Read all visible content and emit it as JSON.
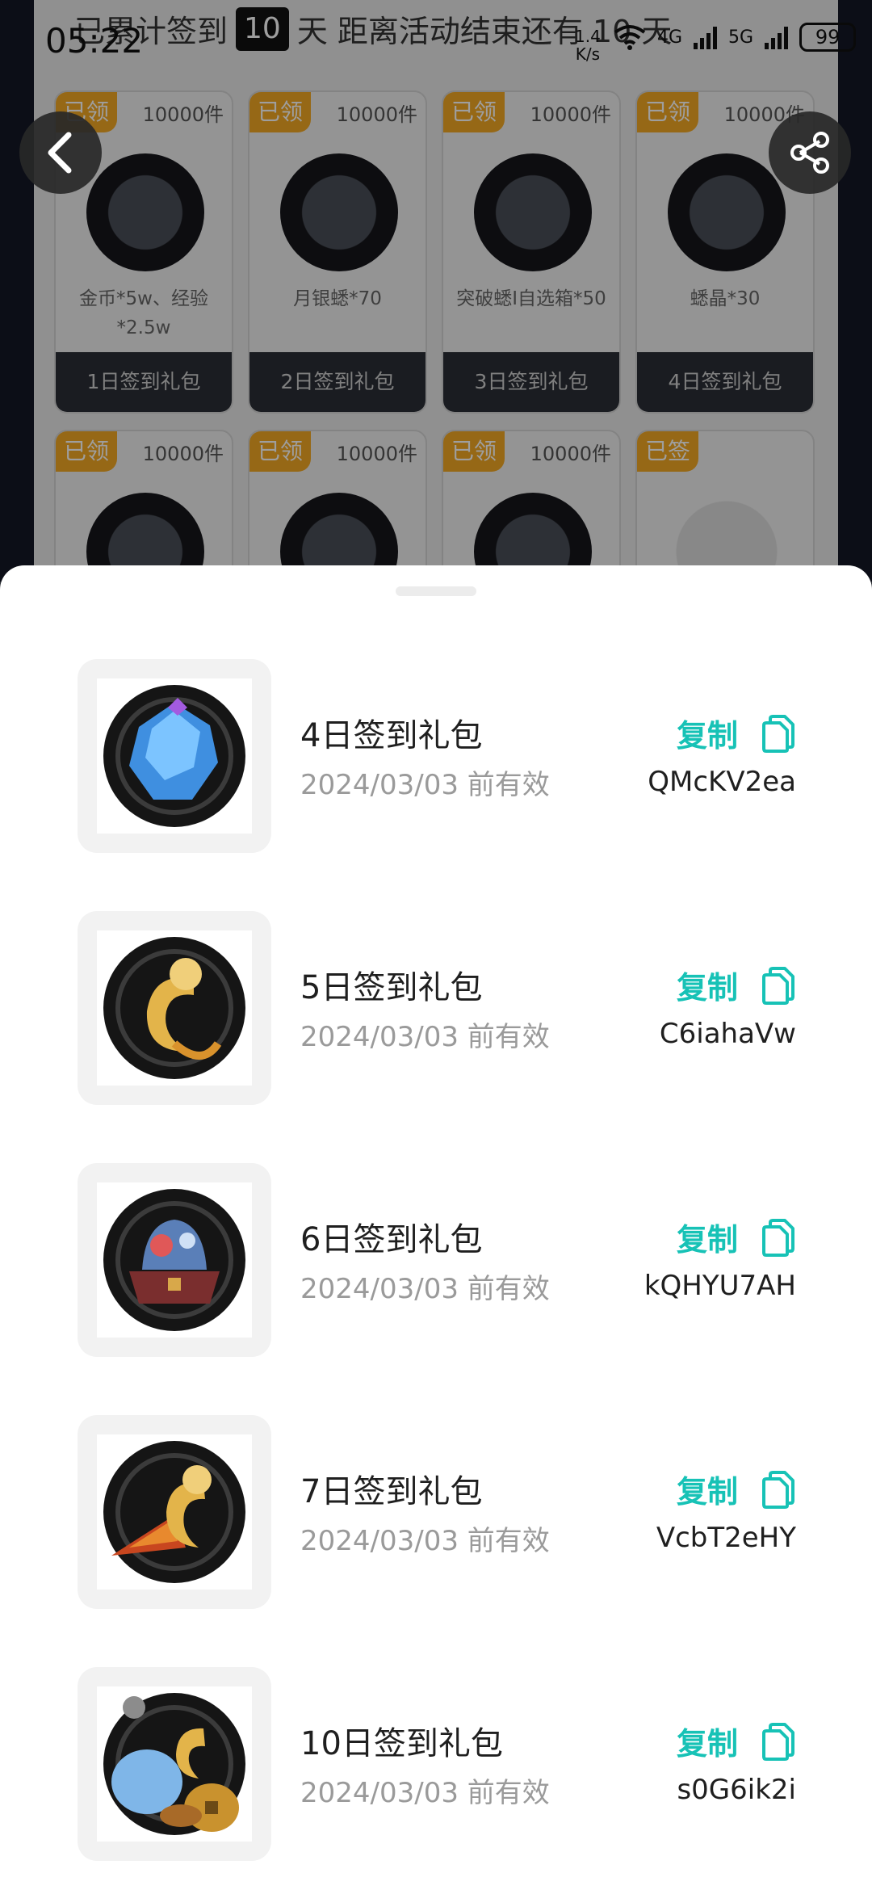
{
  "status_bar": {
    "time": "05:22",
    "net_speed": "1.4",
    "net_unit": "K/s",
    "signal_4g": "4G",
    "signal_5g": "5G",
    "battery": "99"
  },
  "background": {
    "headline_prefix": "已累计签到",
    "headline_days": "10",
    "headline_suffix": "天  距离活动结束还有 10 天",
    "cards": [
      {
        "tag": "已领",
        "count": "10000件",
        "name": "金币*5w、经验*2.5w",
        "footer": "1日签到礼包"
      },
      {
        "tag": "已领",
        "count": "10000件",
        "name": "月银蟋*70",
        "footer": "2日签到礼包"
      },
      {
        "tag": "已领",
        "count": "10000件",
        "name": "突破蟋I自选箱*50",
        "footer": "3日签到礼包"
      },
      {
        "tag": "已领",
        "count": "10000件",
        "name": "蟋晶*30",
        "footer": "4日签到礼包"
      },
      {
        "tag": "已领",
        "count": "10000件"
      },
      {
        "tag": "已领",
        "count": "10000件"
      },
      {
        "tag": "已领",
        "count": "10000件"
      },
      {
        "tag": "已签"
      }
    ]
  },
  "sheet": {
    "copy_label": "复制",
    "items": [
      {
        "title": "4日签到礼包",
        "expiry": "2024/03/03 前有效",
        "code": "QMcKV2ea",
        "icon": "blue-crystal-icon"
      },
      {
        "title": "5日签到礼包",
        "expiry": "2024/03/03 前有效",
        "code": "C6iahaVw",
        "icon": "gold-gourd-icon"
      },
      {
        "title": "6日签到礼包",
        "expiry": "2024/03/03 前有效",
        "code": "kQHYU7AH",
        "icon": "treasure-chest-icon"
      },
      {
        "title": "7日签到礼包",
        "expiry": "2024/03/03 前有效",
        "code": "VcbT2eHY",
        "icon": "gourd-horn-icon"
      },
      {
        "title": "10日签到礼包",
        "expiry": "2024/03/03 前有效",
        "code": "s0G6ik2i",
        "icon": "coin-bundle-icon"
      }
    ]
  },
  "colors": {
    "accent": "#17c2b6",
    "tag": "#f3a824"
  }
}
